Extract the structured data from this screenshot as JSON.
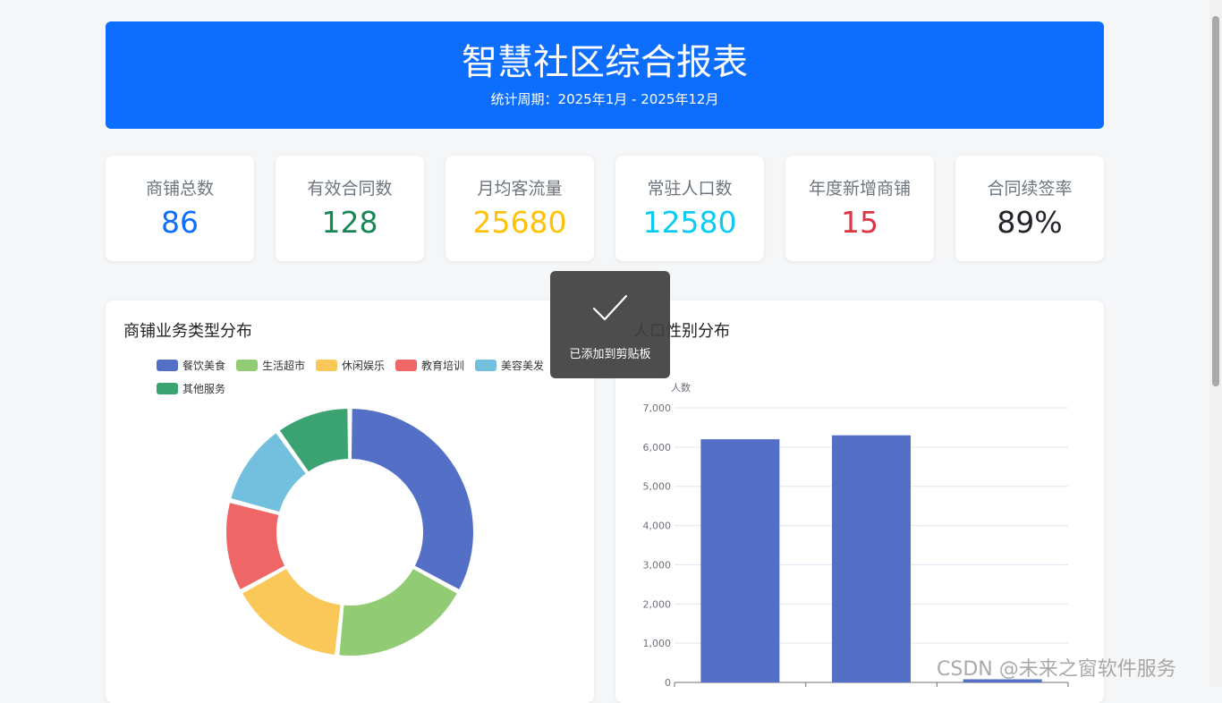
{
  "header": {
    "title": "智慧社区综合报表",
    "period": "统计周期：2025年1月 - 2025年12月",
    "bg_color": "#0d6efd"
  },
  "kpis": [
    {
      "label": "商铺总数",
      "value": "86",
      "color": "#0d6efd"
    },
    {
      "label": "有效合同数",
      "value": "128",
      "color": "#198754"
    },
    {
      "label": "月均客流量",
      "value": "25680",
      "color": "#ffc107"
    },
    {
      "label": "常驻人口数",
      "value": "12580",
      "color": "#0dcaf0"
    },
    {
      "label": "年度新增商铺",
      "value": "15",
      "color": "#dc3545"
    },
    {
      "label": "合同续签率",
      "value": "89%",
      "color": "#212529"
    }
  ],
  "panels": {
    "left_title": "商铺业务类型分布",
    "right_title": "人口性别分布"
  },
  "toast": {
    "message": "已添加到剪贴板",
    "icon": "check-icon"
  },
  "watermark": "CSDN @未来之窗软件服务",
  "chart_data": [
    {
      "type": "pie",
      "variant": "donut",
      "title": "商铺业务类型分布",
      "legend_position": "top",
      "categories": [
        "餐饮美食",
        "生活超市",
        "休闲娱乐",
        "教育培训",
        "美容美发",
        "其他服务"
      ],
      "values": [
        30,
        17,
        14,
        11,
        10,
        9
      ],
      "colors": [
        "#5470c6",
        "#91cc75",
        "#fac858",
        "#ee6666",
        "#73c0de",
        "#3ba272"
      ]
    },
    {
      "type": "bar",
      "title": "人口性别分布",
      "ylabel": "人数",
      "ylim": [
        0,
        7000
      ],
      "yticks": [
        "0",
        "1,000",
        "2,000",
        "3,000",
        "4,000",
        "5,000",
        "6,000",
        "7,000"
      ],
      "values": [
        6200,
        6300,
        80
      ],
      "color": "#5470c6",
      "grid": true
    }
  ]
}
